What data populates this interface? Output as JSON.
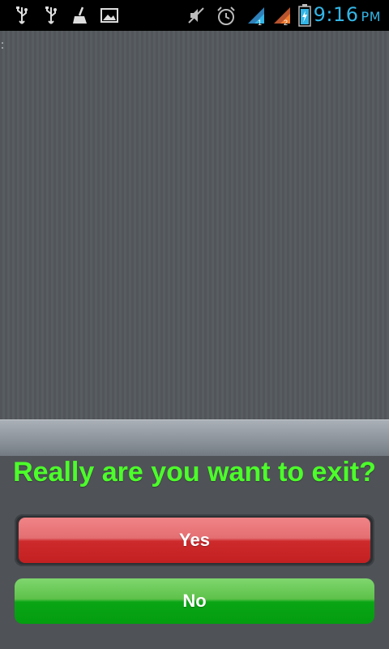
{
  "status_bar": {
    "time": "9:16",
    "ampm": "PM",
    "icons_left": [
      "usb-icon",
      "usb-icon",
      "broom-icon",
      "image-icon"
    ],
    "icons_right": [
      "mute-icon",
      "alarm-icon",
      "signal-sim1-icon",
      "signal-sim2-icon",
      "battery-charging-icon"
    ],
    "sim1_label": "1",
    "sim2_label": "2",
    "accent_color": "#33b5e5"
  },
  "dialog": {
    "question": "Really are you want to exit?",
    "yes_label": "Yes",
    "no_label": "No",
    "question_color": "#4cff2a",
    "yes_color": "#c32022",
    "no_color": "#039d10"
  }
}
